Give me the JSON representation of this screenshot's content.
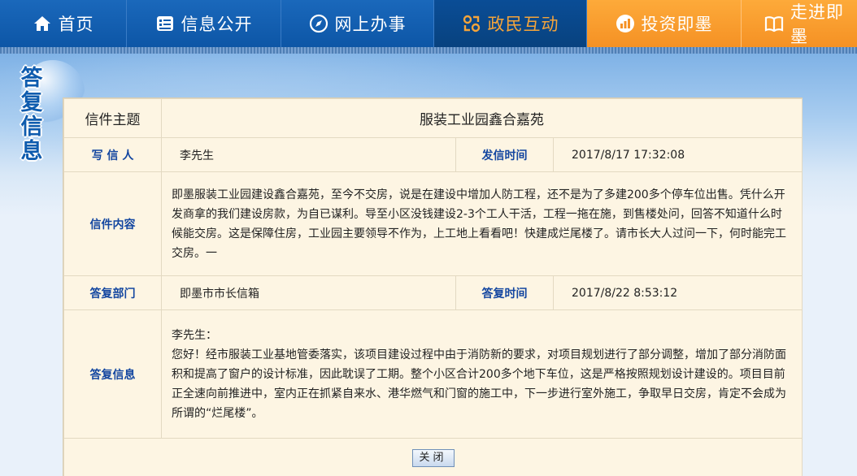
{
  "nav": {
    "items": [
      {
        "label": "首页",
        "icon": "home-icon"
      },
      {
        "label": "信息公开",
        "icon": "info-icon"
      },
      {
        "label": "网上办事",
        "icon": "compass-icon"
      },
      {
        "label": "政民互动",
        "icon": "interaction-icon"
      },
      {
        "label": "投资即墨",
        "icon": "chart-icon"
      },
      {
        "label": "走进即墨",
        "icon": "book-icon"
      }
    ]
  },
  "side_title": [
    "答",
    "复",
    "信",
    "息"
  ],
  "letter": {
    "subject_label": "信件主题",
    "subject": "服装工业园鑫合嘉苑",
    "writer_label": "写 信 人",
    "writer": "李先生",
    "send_time_label": "发信时间",
    "send_time": "2017/8/17 17:32:08",
    "content_label": "信件内容",
    "content": "即墨服装工业园建设鑫合嘉苑，至今不交房，说是在建设中增加人防工程，还不是为了多建200多个停车位出售。凭什么开发商拿的我们建设房款，为自已谋利。导至小区没钱建设2-3个工人干活，工程一拖在施，到售楼处问，回答不知道什么时候能交房。这是保障住房，工业园主要领导不作为，上工地上看看吧！快建成烂尾楼了。请市长大人过问一下，何时能完工交房。一",
    "dept_label": "答复部门",
    "dept": "即墨市市长信箱",
    "reply_time_label": "答复时间",
    "reply_time": "2017/8/22 8:53:12",
    "reply_label": "答复信息",
    "reply_greeting": "李先生：",
    "reply_body": "您好！经市服装工业基地管委落实，该项目建设过程中由于消防新的要求，对项目规划进行了部分调整，增加了部分消防面积和提高了窗户的设计标准，因此耽误了工期。整个小区合计200多个地下车位，这是严格按照规划设计建设的。项目目前正全速向前推进中，室内正在抓紧自来水、港华燃气和门窗的施工中，下一步进行室外施工，争取早日交房，肯定不会成为所谓的“烂尾楼”。"
  },
  "close_label": "关闭"
}
